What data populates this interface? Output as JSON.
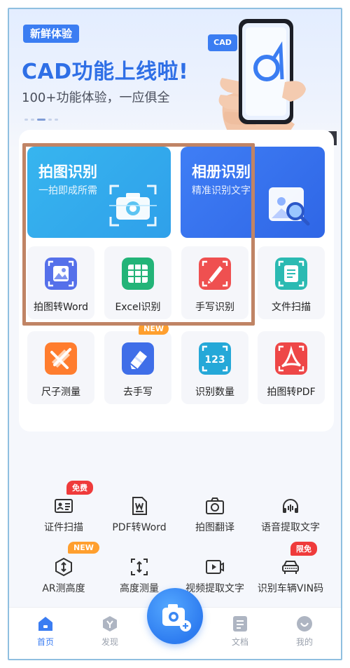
{
  "banner": {
    "badge": "新鲜体验",
    "title": "CAD功能上线啦!",
    "subtitle": "100+功能体验，一应俱全",
    "phone_label": "CAD"
  },
  "big_tiles": {
    "photo": {
      "title": "拍图识别",
      "subtitle": "一拍即成所需"
    },
    "album": {
      "title": "相册识别",
      "subtitle": "精准识别文字"
    }
  },
  "grid": [
    {
      "label": "拍图转Word",
      "icon": "photo-word-icon",
      "color": "#4f6fe8"
    },
    {
      "label": "Excel识别",
      "icon": "excel-grid-icon",
      "color": "#1fae72"
    },
    {
      "label": "手写识别",
      "icon": "handwriting-pen-icon",
      "color": "#ee4c4c"
    },
    {
      "label": "文件扫描",
      "icon": "document-scan-icon",
      "color": "#28b8b0"
    },
    {
      "label": "尺子测量",
      "icon": "ruler-icon",
      "color": "#ff7a2e"
    },
    {
      "label": "去手写",
      "icon": "eraser-icon",
      "color": "#3f6ee8",
      "tag": "NEW"
    },
    {
      "label": "识别数量",
      "icon": "count-123-icon",
      "color": "#24a7d8",
      "inner": "123"
    },
    {
      "label": "拍图转PDF",
      "icon": "pdf-icon",
      "color": "#ee4545"
    }
  ],
  "tools": [
    {
      "label": "证件扫描",
      "icon": "id-card-icon",
      "tag": "免费",
      "tag_color": "red"
    },
    {
      "label": "PDF转Word",
      "icon": "pdf-word-icon"
    },
    {
      "label": "拍图翻译",
      "icon": "photo-translate-icon"
    },
    {
      "label": "语音提取文字",
      "icon": "voice-extract-icon"
    },
    {
      "label": "AR测高度",
      "icon": "ar-height-icon",
      "tag": "NEW",
      "tag_color": "orange"
    },
    {
      "label": "高度测量",
      "icon": "height-measure-icon"
    },
    {
      "label": "视频提取文字",
      "icon": "video-extract-icon"
    },
    {
      "label": "识别车辆VIN码",
      "icon": "vin-code-icon",
      "tag": "限免",
      "tag_color": "red"
    }
  ],
  "nav": [
    {
      "label": "首页",
      "icon": "home-icon",
      "active": true
    },
    {
      "label": "发现",
      "icon": "discover-icon"
    },
    {
      "label": "文档",
      "icon": "document-icon"
    },
    {
      "label": "我的",
      "icon": "profile-icon"
    }
  ],
  "colors": {
    "accent": "#3b7df2",
    "highlight_border": "#c08465"
  }
}
